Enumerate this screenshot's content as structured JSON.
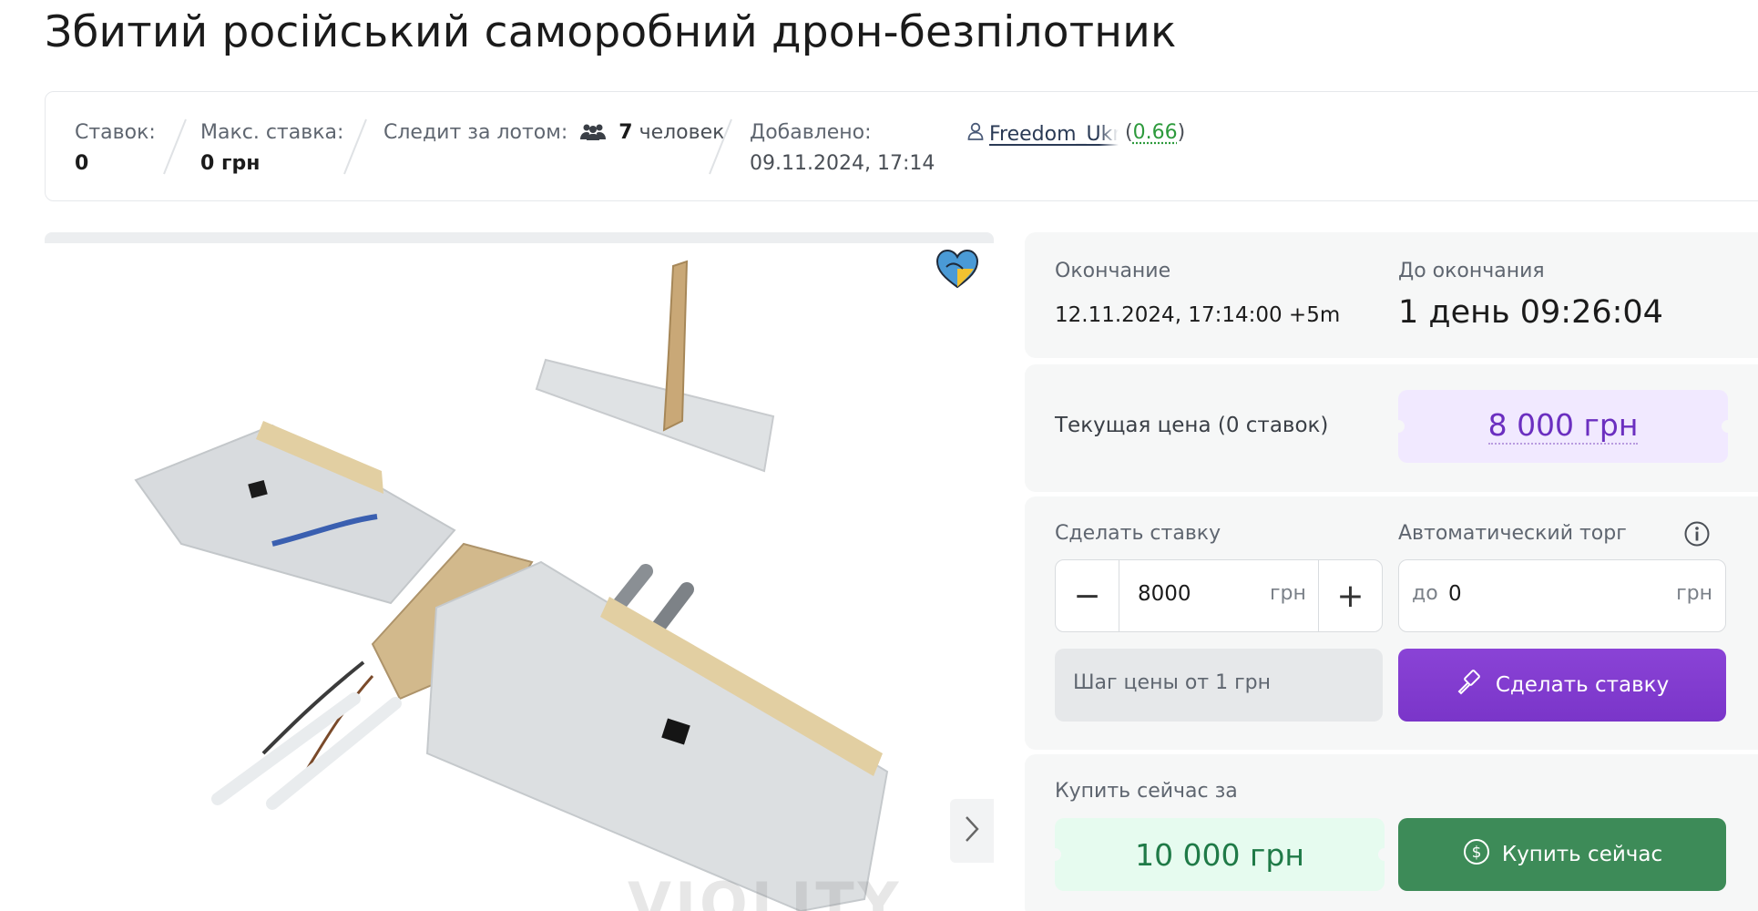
{
  "title": "Збитий російський саморобний дрон-безпілотник",
  "info": {
    "bids_label": "Ставок:",
    "bids_value": "0",
    "max_bid_label": "Макс. ставка:",
    "max_bid_value": "0 грн",
    "watchers_label": "Следит за лотом:",
    "watchers_count": "7",
    "watchers_unit": "человек",
    "added_label": "Добавлено:",
    "added_value": "09.11.2024, 17:14",
    "seller_name": "Freedom_Ukr",
    "seller_rating": "0.66",
    "paren_open": "(",
    "paren_close": ")"
  },
  "gallery": {
    "watermark": "VIOLITY",
    "next_icon": "chevron-right-icon",
    "badge_icon": "charity-heart-icon"
  },
  "ending": {
    "end_label": "Окончание",
    "end_value": "12.11.2024, 17:14:00 +5m",
    "left_label": "До окончания",
    "left_value": "1 день 09:26:04"
  },
  "current": {
    "label": "Текущая цена (0 ставок)",
    "price": "8 000 грн"
  },
  "bid": {
    "make_bid_label": "Сделать ставку",
    "auto_label": "Автоматический торг",
    "minus": "−",
    "plus": "+",
    "amount": "8000",
    "currency": "грн",
    "auto_prefix": "до",
    "auto_value": "0",
    "auto_currency": "грн",
    "step_text": "Шаг цены от 1 грн",
    "bid_button": "Сделать ставку"
  },
  "buy": {
    "label": "Купить сейчас за",
    "price": "10 000 грн",
    "button": "Купить сейчас"
  },
  "colors": {
    "purple": "#7a35c9",
    "green_button": "#3d8b58",
    "price_purple": "#6b2fc0",
    "price_green": "#1f7a47"
  }
}
